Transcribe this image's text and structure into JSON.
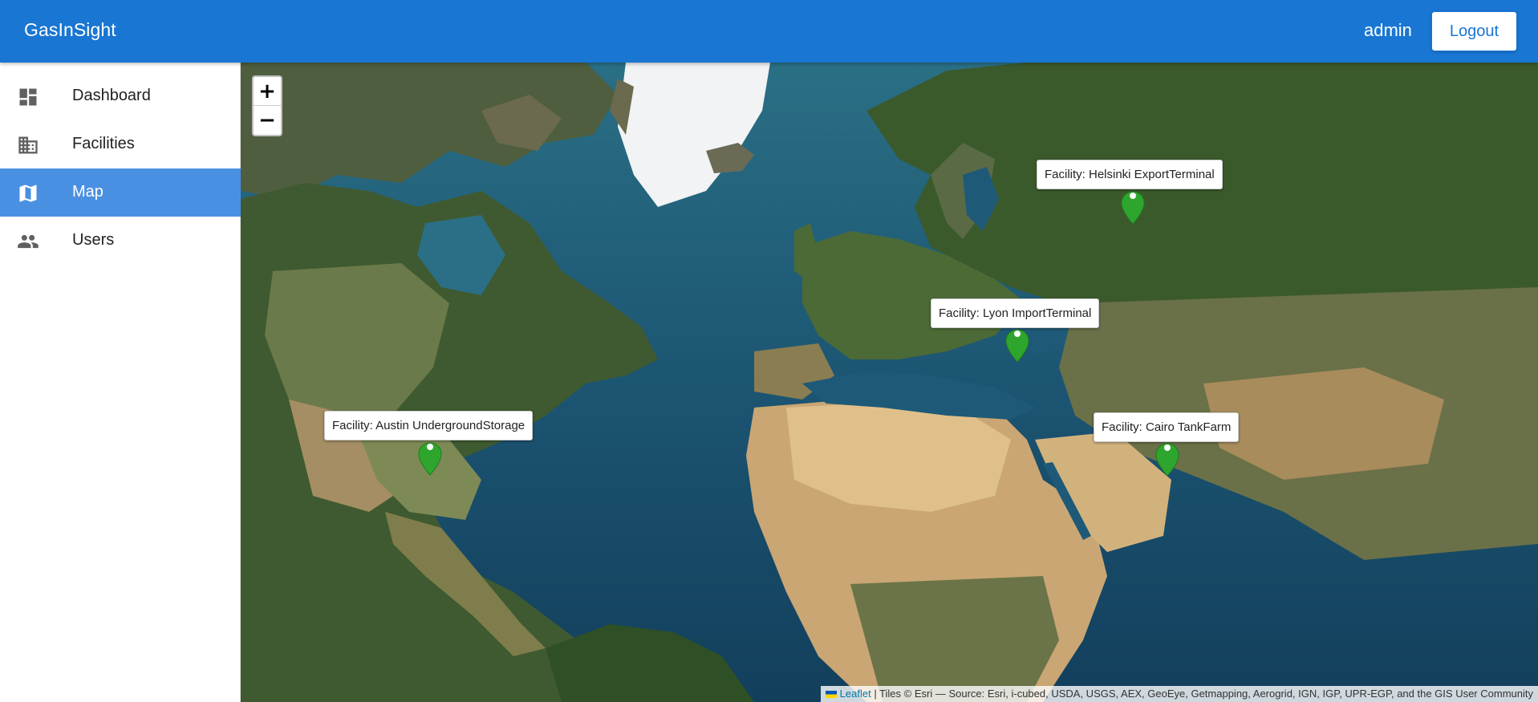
{
  "app": {
    "title": "GasInSight"
  },
  "header": {
    "username": "admin",
    "logout_label": "Logout"
  },
  "sidebar": {
    "items": [
      {
        "label": "Dashboard",
        "icon": "dashboard-icon",
        "active": false
      },
      {
        "label": "Facilities",
        "icon": "building-icon",
        "active": false
      },
      {
        "label": "Map",
        "icon": "map-icon",
        "active": true
      },
      {
        "label": "Users",
        "icon": "users-icon",
        "active": false
      }
    ]
  },
  "map": {
    "zoom_in": "+",
    "zoom_out": "−",
    "markers": [
      {
        "label": "Facility: Helsinki ExportTerminal",
        "color": "#2ea62e"
      },
      {
        "label": "Facility: Lyon ImportTerminal",
        "color": "#2ea62e"
      },
      {
        "label": "Facility: Austin UndergroundStorage",
        "color": "#2ea62e"
      },
      {
        "label": "Facility: Cairo TankFarm",
        "color": "#2ea62e"
      }
    ],
    "attribution": {
      "link": "Leaflet",
      "text": " | Tiles © Esri — Source: Esri, i-cubed, USDA, USGS, AEX, GeoEye, Getmapping, Aerogrid, IGN, IGP, UPR-EGP, and the GIS User Community"
    }
  },
  "colors": {
    "primary": "#1976d2",
    "active_nav": "#4a90e2",
    "marker": "#2ea62e"
  }
}
